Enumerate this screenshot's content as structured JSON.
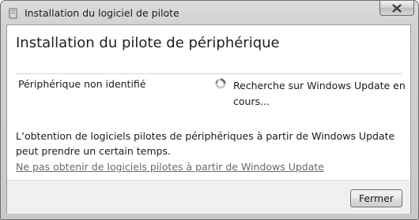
{
  "window": {
    "title": "Installation du logiciel de pilote",
    "app_icon": "driver-package-icon",
    "close_icon": "close-icon"
  },
  "content": {
    "heading": "Installation du pilote de périphérique",
    "device": {
      "name": "Périphérique non identifié",
      "status_icon": "busy-spinner-icon",
      "status": "Recherche sur Windows Update en cours..."
    },
    "info": "L’obtention de logiciels pilotes de périphériques à partir de Windows Update peut prendre un certain temps.",
    "skip_link": "Ne pas obtenir de logiciels pilotes à partir de Windows Update"
  },
  "footer": {
    "close_label": "Fermer"
  },
  "colors": {
    "frame": "#cfcfcf",
    "client_background": "#ffffff",
    "footer_background": "#f0f0f0",
    "link": "#6a6a6a"
  }
}
